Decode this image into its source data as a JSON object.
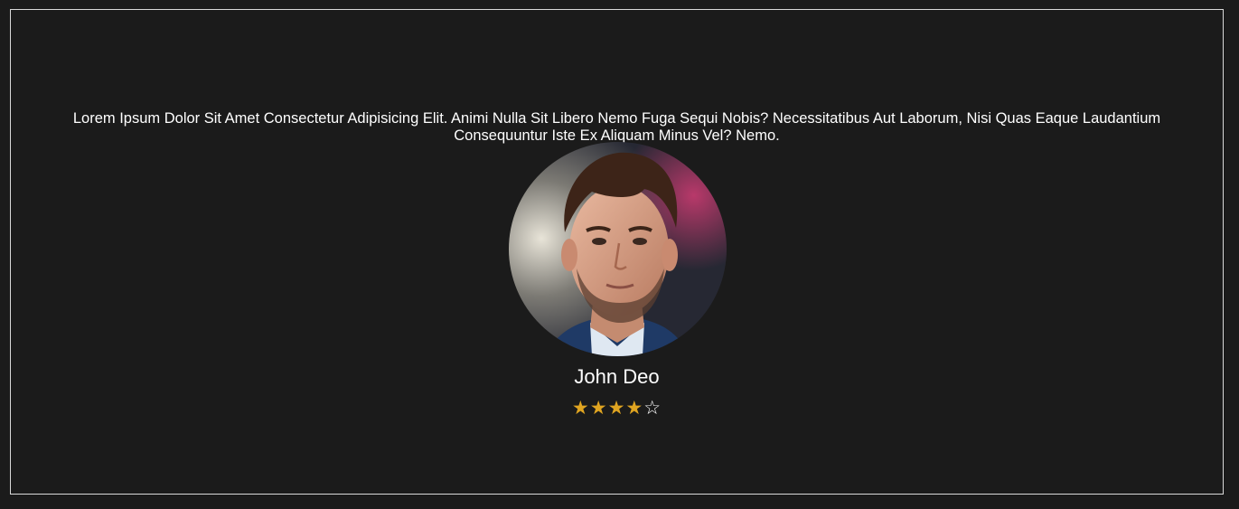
{
  "testimonial": {
    "quote": "Lorem Ipsum Dolor Sit Amet Consectetur Adipisicing Elit. Animi Nulla Sit Libero Nemo Fuga Sequi Nobis? Necessitatibus Aut Laborum, Nisi Quas Eaque Laudantium Consequuntur Iste Ex Aliquam Minus Vel? Nemo.",
    "name": "John Deo",
    "rating": {
      "value": 4,
      "max": 5
    }
  },
  "icons": {
    "star_filled": "star-filled-icon",
    "star_empty": "star-outline-icon"
  },
  "colors": {
    "background": "#1b1b1b",
    "border": "#d9d9d9",
    "text": "#ffffff",
    "star": "#e0a521"
  }
}
